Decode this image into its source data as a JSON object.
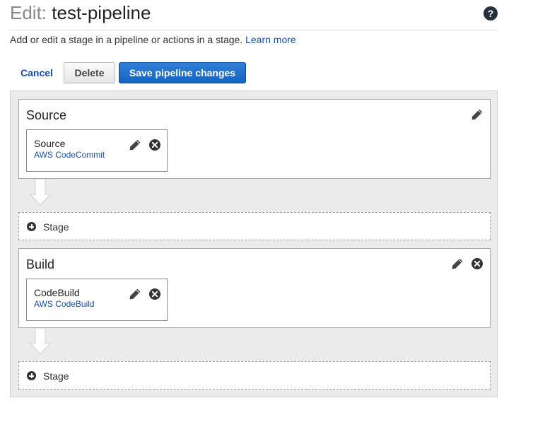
{
  "header": {
    "title_prefix": "Edit:",
    "title_name": "test-pipeline",
    "help_glyph": "?",
    "subtitle": "Add or edit a stage in a pipeline or actions in a stage.",
    "learn_more": "Learn more"
  },
  "toolbar": {
    "cancel_label": "Cancel",
    "delete_label": "Delete",
    "save_label": "Save pipeline changes"
  },
  "stages": [
    {
      "name": "Source",
      "actions": [
        {
          "name": "Source",
          "provider": "AWS CodeCommit"
        }
      ]
    },
    {
      "name": "Build",
      "actions": [
        {
          "name": "CodeBuild",
          "provider": "AWS CodeBuild"
        }
      ]
    }
  ],
  "add_stage_label": "Stage",
  "icons": {
    "edit": "pencil-icon",
    "remove": "close-circle-icon",
    "add": "plus-circle-icon",
    "flow": "down-arrow-icon",
    "help": "help-circle-icon"
  },
  "colors": {
    "link": "#1a4fa0",
    "primary_button": "#1565c0",
    "canvas_background": "#ebebeb",
    "title_prefix": "#888888"
  }
}
